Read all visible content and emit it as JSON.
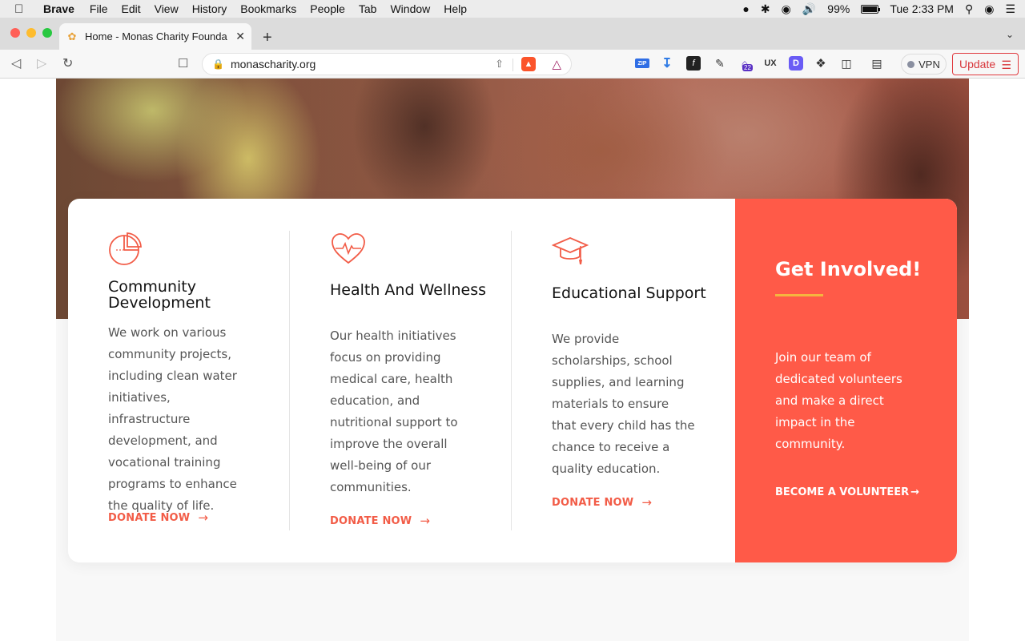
{
  "menubar": {
    "app_name": "Brave",
    "items": [
      "File",
      "Edit",
      "View",
      "History",
      "Bookmarks",
      "People",
      "Tab",
      "Window",
      "Help"
    ],
    "battery_percent": "99%",
    "battery_level": 0.99,
    "clock": "Tue 2:33 PM"
  },
  "browser": {
    "tab": {
      "title": "Home - Monas Charity Foundation",
      "favicon": "people-logo-icon"
    },
    "url": "monascharity.org",
    "extensions": {
      "zip_label": "ZIP",
      "fx_label": "f",
      "ux_label": "UX",
      "d_label": "D",
      "house_badge": "22"
    },
    "vpn_label": "VPN",
    "update_label": "Update"
  },
  "services": [
    {
      "icon": "pie-chart-icon",
      "title": "Community Development",
      "body": "We work on various community projects, including clean water initiatives, infrastructure development, and vocational training programs to enhance the quality of life.",
      "cta": "DONATE NOW"
    },
    {
      "icon": "heart-pulse-icon",
      "title": "Health And Wellness",
      "body": "Our health initiatives focus on providing medical care, health education, and nutritional support to improve the overall well-being of our communities.",
      "cta": "DONATE NOW"
    },
    {
      "icon": "graduation-cap-icon",
      "title": "Educational Support",
      "body": "We provide scholarships, school supplies, and learning materials to ensure that every child has the chance to receive a quality education.",
      "cta": "DONATE NOW"
    }
  ],
  "get_involved": {
    "title": "Get Involved!",
    "body": "Join our team of dedicated volunteers and make a direct impact in the community.",
    "cta": "BECOME A VOLUNTEER"
  },
  "colors": {
    "accent": "#ff5a48",
    "accent_text": "#f25c47",
    "underline": "#f5b53f"
  }
}
